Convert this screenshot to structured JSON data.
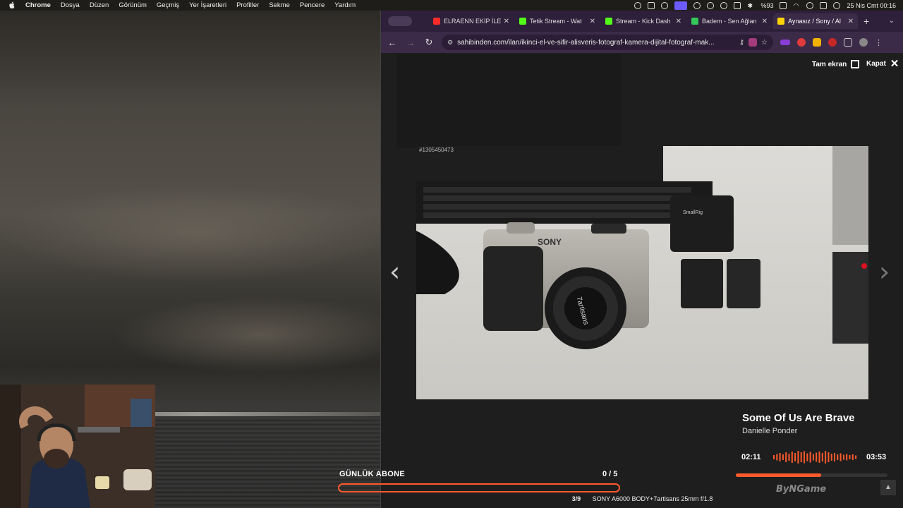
{
  "menubar": {
    "app": "Chrome",
    "items": [
      "Dosya",
      "Düzen",
      "Görünüm",
      "Geçmiş",
      "Yer İşaretleri",
      "Profiller",
      "Sekme",
      "Pencere",
      "Yardım"
    ],
    "battery": "%93",
    "datetime": "25 Nis Cmt  00:16"
  },
  "tabs": [
    {
      "label": "ELRAENN EKİP İLE",
      "favicon_color": "#ff2a2a",
      "active": false
    },
    {
      "label": "Tetik Stream - Wat",
      "favicon_color": "#53fc18",
      "active": false
    },
    {
      "label": "Stream - Kick Dash",
      "favicon_color": "#53fc18",
      "active": false
    },
    {
      "label": "Badem - Sen Ağlan",
      "favicon_color": "#34c759",
      "active": false
    },
    {
      "label": "Aynasız / Sony / Al",
      "favicon_color": "#ffd400",
      "active": true
    }
  ],
  "toolbar": {
    "url": "sahibinden.com/ilan/ikinci-el-ve-sifir-alisveris-fotograf-kamera-dijital-fotograf-mak..."
  },
  "lightbox": {
    "fullscreen_label": "Tam ekran",
    "close_label": "Kapat",
    "image_id": "#1305450473",
    "counter": "3/9",
    "caption": "SONY A6000 BODY+7artisans 25mm f/1.8",
    "photo_texts": {
      "brand": "SONY",
      "lens": "7artisans",
      "charger": "SmallRig"
    }
  },
  "overlay": {
    "subscriber_goal_label": "GÜNLÜK ABONE",
    "subscriber_goal_count": "0 / 5",
    "subscriber_goal_progress": 0.0
  },
  "now_playing": {
    "title": "Some Of Us Are Brave",
    "artist": "Danielle Ponder",
    "elapsed": "02:11",
    "total": "03:53",
    "progress": 0.5622
  },
  "colors": {
    "accent": "#ff5a2c",
    "tabbar": "#2e1f3a",
    "toolbar": "#3c2b48"
  }
}
